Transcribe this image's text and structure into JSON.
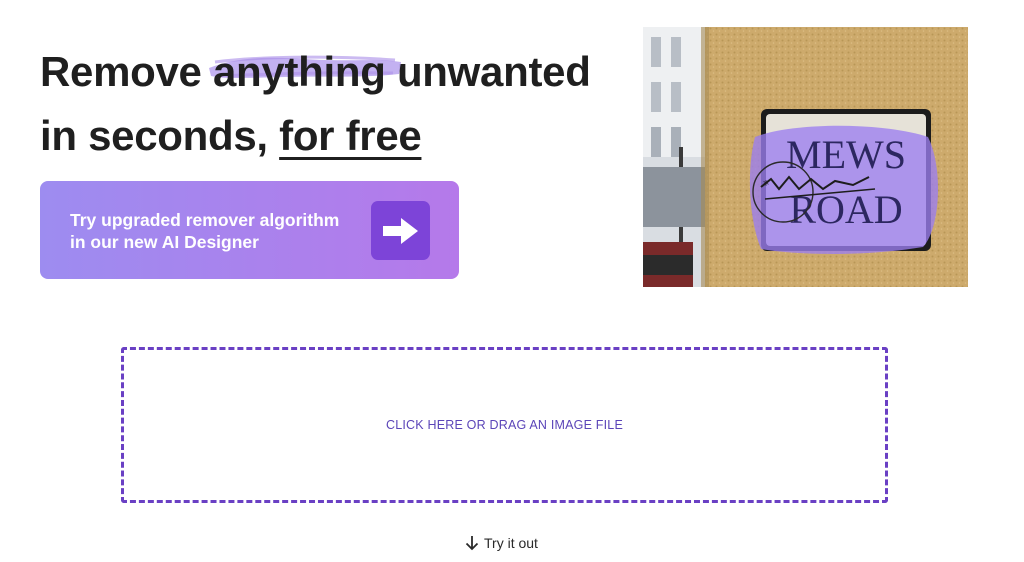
{
  "headline": {
    "word_1": "Remove",
    "highlighted_word": "anything",
    "word_3": "unwanted",
    "line_2_prefix": "in seconds,",
    "line_2_underlined": "for free"
  },
  "promo": {
    "line_1": "Try upgraded remover algorithm",
    "line_2": "in our new AI Designer",
    "icon": "arrow-right-icon"
  },
  "hero_image": {
    "sign_line_1": "MEWS",
    "sign_line_2": "ROAD"
  },
  "dropzone": {
    "label": "CLICK HERE OR DRAG AN IMAGE FILE"
  },
  "try_it_out": {
    "label": "Try it out",
    "icon": "arrow-down-icon"
  },
  "colors": {
    "accent": "#6a40c4",
    "promo_gradient_start": "#9d8cf0",
    "promo_gradient_end": "#b579ea",
    "arrow_box": "#7d44d8",
    "highlight_brush": "#b9a3ef"
  }
}
